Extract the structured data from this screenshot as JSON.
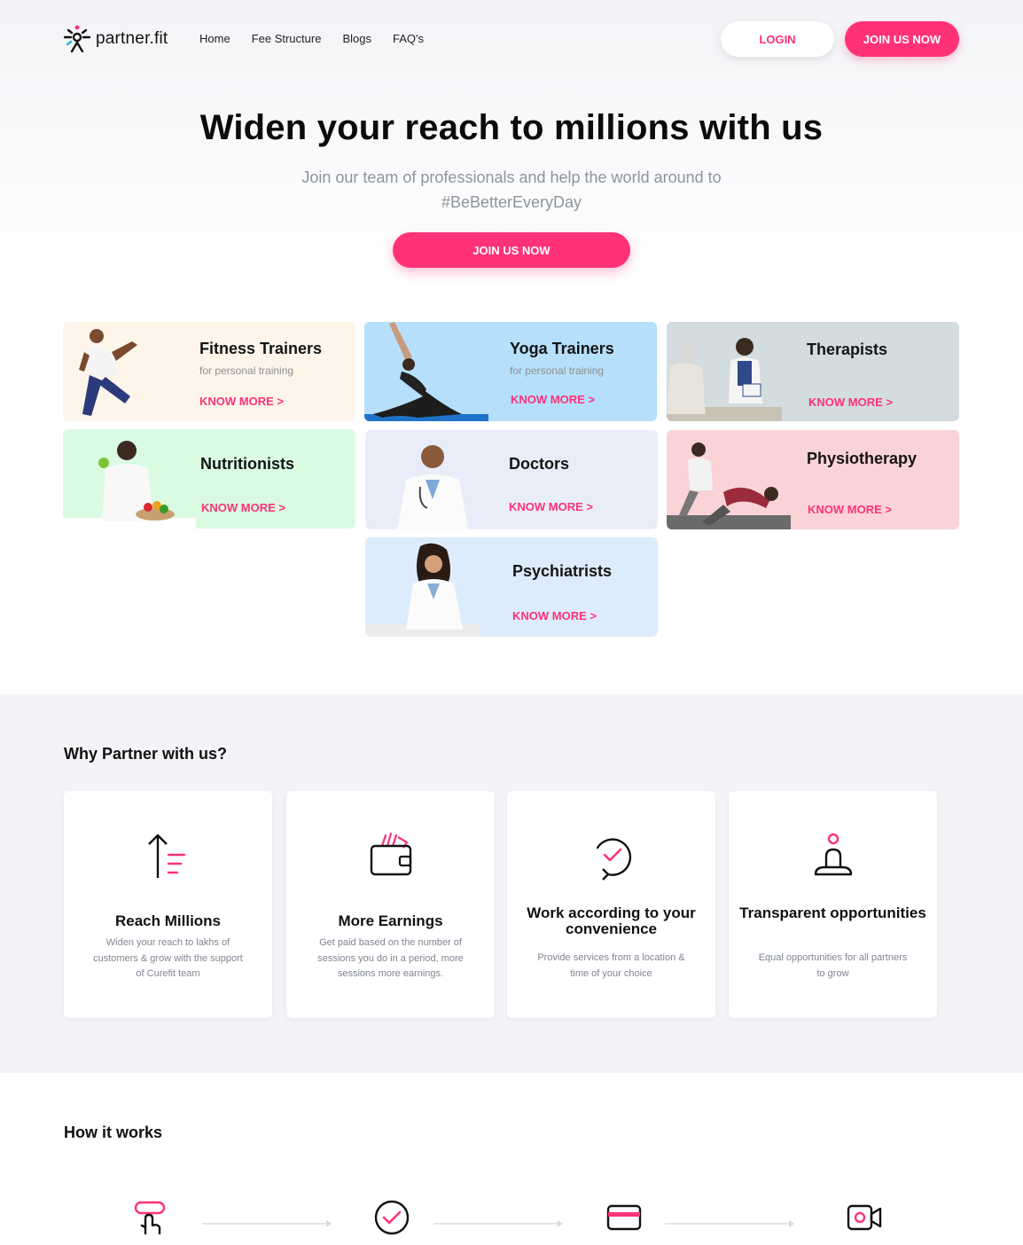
{
  "brand": {
    "name": "partner.fit",
    "accent": "#ff3278"
  },
  "nav": {
    "items": [
      "Home",
      "Fee Structure",
      "Blogs",
      "FAQ's"
    ]
  },
  "header": {
    "login_label": "LOGIN",
    "join_label": "JOIN US NOW"
  },
  "hero": {
    "title": "Widen your reach to millions with us",
    "subtitle": "Join our team of professionals and help the world around to #BeBetterEveryDay",
    "cta": "JOIN US NOW"
  },
  "categories": [
    {
      "title": "Fitness Trainers",
      "subtitle": "for personal training",
      "link": "KNOW MORE >",
      "bg": "#fdf5ea"
    },
    {
      "title": "Yoga Trainers",
      "subtitle": "for personal training",
      "link": "KNOW MORE >",
      "bg": "#b6dffb"
    },
    {
      "title": "Therapists",
      "subtitle": "",
      "link": "KNOW MORE >",
      "bg": "#d3dcde"
    },
    {
      "title": "Nutritionists",
      "subtitle": "",
      "link": "KNOW MORE >",
      "bg": "#dafbe2"
    },
    {
      "title": "Doctors",
      "subtitle": "",
      "link": "KNOW MORE >",
      "bg": "#e8edf9"
    },
    {
      "title": "Physiotherapy",
      "subtitle": "",
      "link": "KNOW MORE >",
      "bg": "#fad3d7"
    },
    {
      "title": "Psychiatrists",
      "subtitle": "",
      "link": "KNOW MORE >",
      "bg": "#dcecfc"
    }
  ],
  "why": {
    "heading": "Why Partner with us?",
    "cards": [
      {
        "title": "Reach Millions",
        "desc": "Widen your reach to lakhs of customers & grow with the support of Curefit  team",
        "icon": "reach-arrow-icon"
      },
      {
        "title": "More Earnings",
        "desc": "Get paid based on the number of sessions you do in a period, more sessions more earnings.",
        "icon": "wallet-icon"
      },
      {
        "title": "Work according to your convenience",
        "desc": "Provide services from a location & time of your choice",
        "icon": "refresh-check-icon"
      },
      {
        "title": "Transparent opportunities",
        "desc": "Equal opportunities for all partners to grow",
        "icon": "person-meditate-icon"
      }
    ]
  },
  "how": {
    "heading": "How it works",
    "steps": [
      "tap-icon",
      "check-circle-icon",
      "card-icon",
      "video-icon"
    ]
  }
}
